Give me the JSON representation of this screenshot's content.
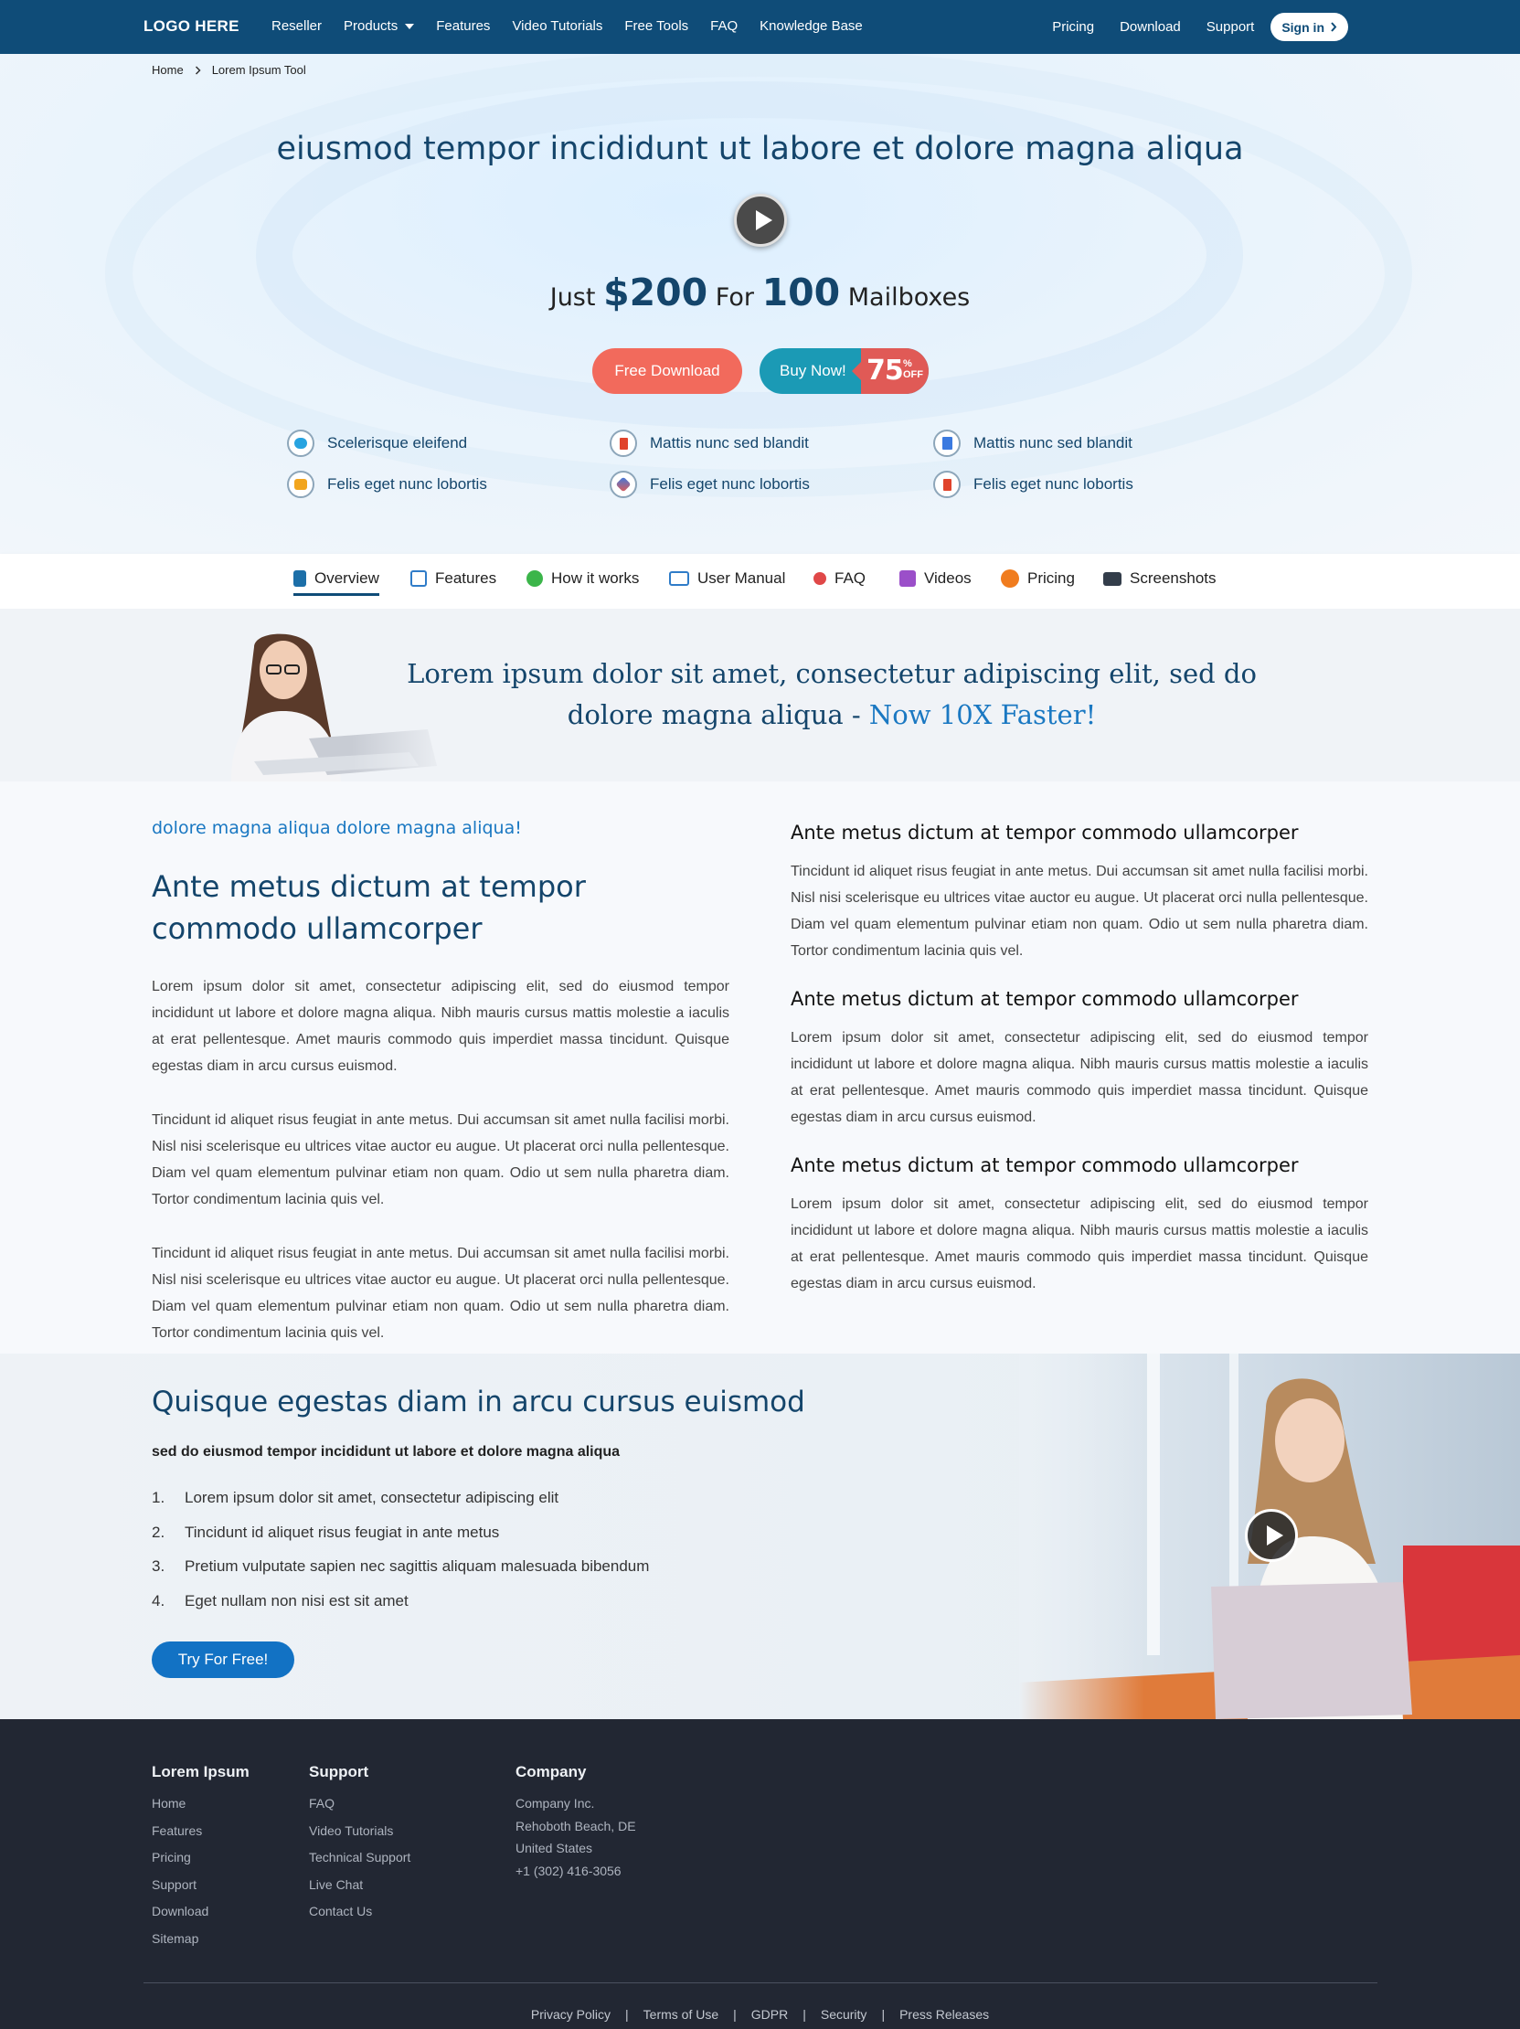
{
  "topnav": {
    "logo": "LOGO HERE",
    "links": [
      "Reseller",
      "Products",
      "Features",
      "Video Tutorials",
      "Free Tools",
      "FAQ",
      "Knowledge Base"
    ],
    "right_links": [
      "Pricing",
      "Download",
      "Support"
    ],
    "signin": "Sign in"
  },
  "hero": {
    "breadcrumb": [
      "Home",
      "Lorem Ipsum Tool"
    ],
    "title": "eiusmod tempor incididunt ut labore et dolore magna aliqua",
    "price_prefix": "Just",
    "price_amount": "$200",
    "price_mid": "For",
    "price_count": "100",
    "price_suffix": "Mailboxes",
    "free_download": "Free Download",
    "buy_now": "Buy Now!",
    "discount_value": "75",
    "discount_pct": "%",
    "discount_off": "OFF",
    "features": [
      {
        "label": "Scelerisque eleifend",
        "icon": "cloud-icon"
      },
      {
        "label": "Mattis nunc sed blandit",
        "icon": "office-icon"
      },
      {
        "label": "Mattis nunc sed blandit",
        "icon": "document-icon"
      },
      {
        "label": "Felis eget nunc lobortis",
        "icon": "folder-icon"
      },
      {
        "label": "Felis eget nunc lobortis",
        "icon": "pen-icon"
      },
      {
        "label": "Felis eget nunc lobortis",
        "icon": "office-icon"
      }
    ]
  },
  "tabs": [
    {
      "label": "Overview",
      "icon": "book-icon",
      "color": "#1c6fa8"
    },
    {
      "label": "Features",
      "icon": "list-icon",
      "color": "#2f7cc8"
    },
    {
      "label": "How it works",
      "icon": "gear-icon",
      "color": "#3bb54a"
    },
    {
      "label": "User Manual",
      "icon": "open-book-icon",
      "color": "#2f7cc8"
    },
    {
      "label": "FAQ",
      "icon": "faq-icon",
      "color": "#e04848"
    },
    {
      "label": "Videos",
      "icon": "video-icon",
      "color": "#9b4fc9"
    },
    {
      "label": "Pricing",
      "icon": "dollar-icon",
      "color": "#f07c1e"
    },
    {
      "label": "Screenshots",
      "icon": "camera-icon",
      "color": "#333d4a"
    }
  ],
  "banner": {
    "text": "Lorem ipsum dolor sit amet, consectetur adipiscing elit, sed do dolore magna aliqua -",
    "highlight": "Now 10X Faster!"
  },
  "content": {
    "kicker": "dolore magna aliqua dolore magna aliqua!",
    "heading": "Ante metus dictum at tempor commodo ullamcorper",
    "paras": [
      "Lorem ipsum dolor sit amet, consectetur adipiscing elit, sed do eiusmod tempor incididunt ut labore et dolore magna aliqua. Nibh mauris cursus mattis molestie a iaculis at erat pellentesque. Amet mauris commodo quis imperdiet massa tincidunt. Quisque egestas diam in arcu cursus euismod.",
      "Tincidunt id aliquet risus feugiat in ante metus. Dui accumsan sit amet nulla facilisi morbi. Nisl nisi scelerisque eu ultrices vitae auctor eu augue. Ut placerat orci nulla pellentesque. Diam vel quam elementum pulvinar etiam non quam. Odio ut sem nulla pharetra diam. Tortor condimentum lacinia quis vel.",
      "Tincidunt id aliquet risus feugiat in ante metus. Dui accumsan sit amet nulla facilisi morbi. Nisl nisi scelerisque eu ultrices vitae auctor eu augue. Ut placerat orci nulla pellentesque. Diam vel quam elementum pulvinar etiam non quam. Odio ut sem nulla pharetra diam. Tortor condimentum lacinia quis vel."
    ],
    "right_blocks": [
      {
        "heading": "Ante metus dictum at tempor commodo ullamcorper",
        "text": "Tincidunt id aliquet risus feugiat in ante metus. Dui accumsan sit amet nulla facilisi morbi. Nisl nisi scelerisque eu ultrices vitae auctor eu augue. Ut placerat orci nulla pellentesque. Diam vel quam elementum pulvinar etiam non quam. Odio ut sem nulla pharetra diam. Tortor condimentum lacinia quis vel."
      },
      {
        "heading": "Ante metus dictum at tempor commodo ullamcorper",
        "text": "Lorem ipsum dolor sit amet, consectetur adipiscing elit, sed do eiusmod tempor incididunt ut labore et dolore magna aliqua. Nibh mauris cursus mattis molestie a iaculis at erat pellentesque. Amet mauris commodo quis imperdiet massa tincidunt. Quisque egestas diam in arcu cursus euismod."
      },
      {
        "heading": "Ante metus dictum at tempor commodo ullamcorper",
        "text": "Lorem ipsum dolor sit amet, consectetur adipiscing elit, sed do eiusmod tempor incididunt ut labore et dolore magna aliqua. Nibh mauris cursus mattis molestie a iaculis at erat pellentesque. Amet mauris commodo quis imperdiet massa tincidunt. Quisque egestas diam in arcu cursus euismod."
      }
    ]
  },
  "promo": {
    "heading": "Quisque egestas diam in arcu cursus euismod",
    "sub": "sed do eiusmod tempor incididunt ut labore et dolore magna aliqua",
    "items": [
      {
        "n": "1.",
        "text": "Lorem ipsum dolor sit amet, consectetur adipiscing elit"
      },
      {
        "n": "2.",
        "text": "Tincidunt id aliquet risus feugiat in ante metus"
      },
      {
        "n": "3.",
        "text": "Pretium vulputate sapien nec sagittis aliquam malesuada bibendum"
      },
      {
        "n": "4.",
        "text": "Eget nullam non nisi est sit amet"
      }
    ],
    "button": "Try For Free!"
  },
  "footer": {
    "col1": {
      "title": "Lorem Ipsum",
      "items": [
        "Home",
        "Features",
        "Pricing",
        "Support",
        "Download",
        "Sitemap"
      ]
    },
    "col2": {
      "title": "Support",
      "items": [
        "FAQ",
        "Video Tutorials",
        "Technical Support",
        "Live Chat",
        "Contact Us"
      ]
    },
    "col3": {
      "title": "Company",
      "lines": [
        "Company Inc.",
        "Rehoboth Beach, DE",
        "United States",
        "+1 (302) 416-3056"
      ]
    },
    "bottom": [
      "Privacy Policy",
      "Terms of Use",
      "GDPR",
      "Security",
      "Press Releases"
    ],
    "separator": "|"
  }
}
